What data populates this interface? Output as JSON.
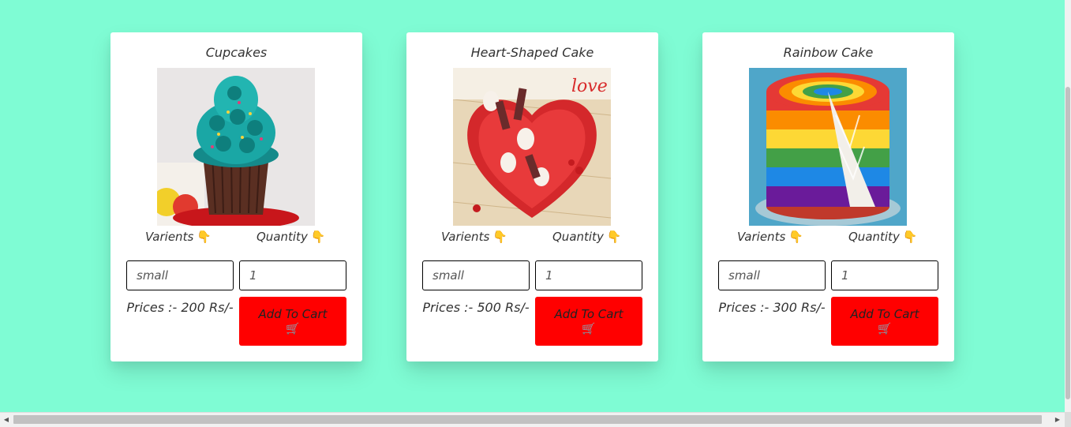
{
  "labels": {
    "varients": "Varients",
    "quantity": "Quantity",
    "add_to_cart": "Add To Cart"
  },
  "products": [
    {
      "title": "Cupcakes",
      "variant": "small",
      "quantity": "1",
      "price_text": "Prices :- 200 Rs/-"
    },
    {
      "title": "Heart-Shaped Cake",
      "variant": "small",
      "quantity": "1",
      "price_text": "Prices :- 500 Rs/-"
    },
    {
      "title": "Rainbow Cake",
      "variant": "small",
      "quantity": "1",
      "price_text": "Prices :- 300 Rs/-"
    }
  ],
  "icons": {
    "pointing_hand": "👇",
    "cart": "🛒"
  },
  "colors": {
    "background": "#7ffcd4",
    "card": "#ffffff",
    "button": "#ff0000"
  }
}
